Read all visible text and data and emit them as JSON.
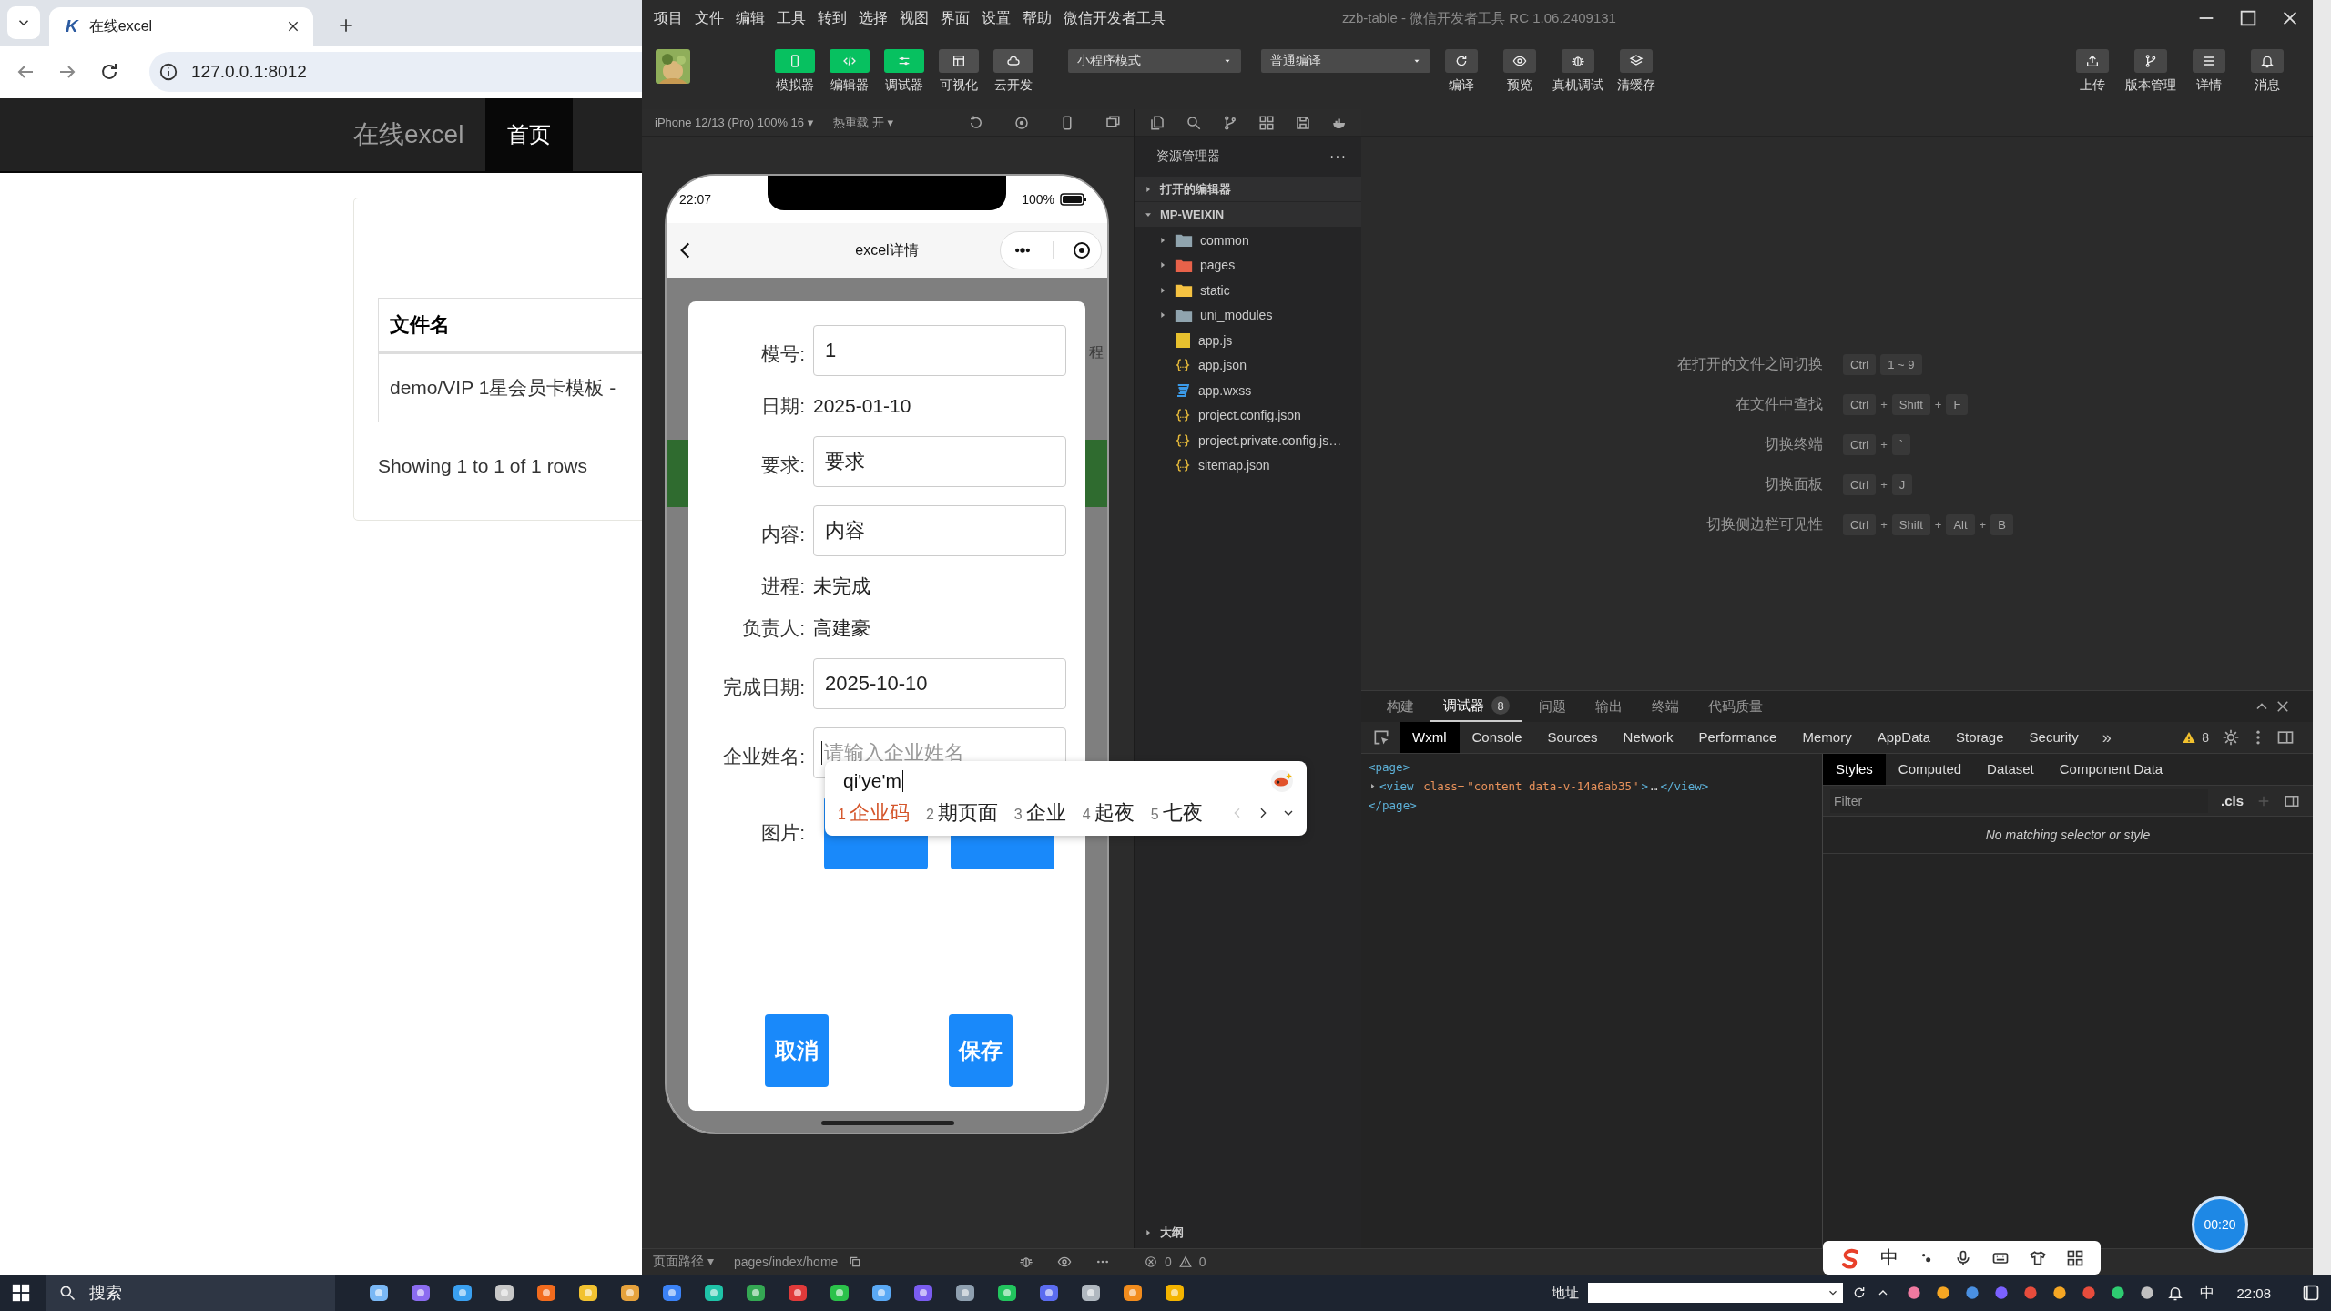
{
  "browser": {
    "tabs": [
      {
        "favicon": "K",
        "title": "在线excel",
        "selected": true
      }
    ],
    "address": "127.0.0.1:8012",
    "site": {
      "brand": "在线excel",
      "nav": [
        {
          "label": "首页",
          "selected": true
        }
      ],
      "table": {
        "columns": [
          "文件名"
        ],
        "rows": [
          [
            "demo/VIP 1星会员卡模板 -"
          ]
        ]
      },
      "pagination": "Showing 1 to 1 of 1 rows"
    }
  },
  "ide": {
    "menu": [
      "项目",
      "文件",
      "编辑",
      "工具",
      "转到",
      "选择",
      "视图",
      "界面",
      "设置",
      "帮助",
      "微信开发者工具"
    ],
    "title": "zzb-table - 微信开发者工具 RC 1.06.2409131",
    "view_buttons": [
      {
        "label": "模拟器",
        "kind": "phone",
        "on": true
      },
      {
        "label": "编辑器",
        "kind": "code",
        "on": true
      },
      {
        "label": "调试器",
        "kind": "sliders",
        "on": true
      },
      {
        "label": "可视化",
        "kind": "layout",
        "on": false
      },
      {
        "label": "云开发",
        "kind": "cloud",
        "on": false
      }
    ],
    "mode_select": "小程序模式",
    "compile_select": "普通编译",
    "actions": [
      {
        "label": "编译",
        "kind": "refresh"
      },
      {
        "label": "预览",
        "kind": "eye"
      },
      {
        "label": "真机调试",
        "kind": "bug"
      },
      {
        "label": "清缓存",
        "kind": "layers"
      }
    ],
    "right_actions": [
      {
        "label": "上传",
        "kind": "upload"
      },
      {
        "label": "版本管理",
        "kind": "branch"
      },
      {
        "label": "详情",
        "kind": "menu"
      },
      {
        "label": "消息",
        "kind": "bell"
      }
    ],
    "simulator": {
      "device": "iPhone 12/13 (Pro) 100% 16 ▾",
      "hot_reload": "热重载 开 ▾",
      "phone": {
        "time": "22:07",
        "battery": "100%",
        "nav_title": "excel详情",
        "behind_text": "程",
        "dialog": {
          "rows": [
            {
              "kind": "input",
              "label": "模号:",
              "value": "1"
            },
            {
              "kind": "text",
              "label": "日期:",
              "value": "2025-01-10"
            },
            {
              "kind": "input",
              "label": "要求:",
              "value": "要求"
            },
            {
              "kind": "input",
              "label": "内容:",
              "value": "内容"
            },
            {
              "kind": "text",
              "label": "进程:",
              "value": "未完成"
            },
            {
              "kind": "text",
              "label": "负责人:",
              "value": "高建豪"
            },
            {
              "kind": "input",
              "label": "完成日期:",
              "value": "2025-10-10"
            },
            {
              "kind": "input",
              "label": "企业姓名:",
              "placeholder": "请输入企业姓名",
              "focused": true
            },
            {
              "kind": "buttons",
              "label": "图片:",
              "buttons": [
                {
                  "kind": "button"
                },
                {
                  "kind": "button"
                }
              ]
            }
          ],
          "actions": [
            "取消",
            "保存"
          ]
        }
      }
    },
    "ime_popup": {
      "composition": "qi'ye'm",
      "candidates": [
        {
          "index": "1",
          "text": "企业码",
          "selected": true
        },
        {
          "index": "2",
          "text": "期页面",
          "selected": false
        },
        {
          "index": "3",
          "text": "企业",
          "selected": false
        },
        {
          "index": "4",
          "text": "起夜",
          "selected": false
        },
        {
          "index": "5",
          "text": "七夜",
          "selected": false
        }
      ]
    },
    "explorer": {
      "title": "资源管理器",
      "more": "···",
      "sections": [
        {
          "label": "打开的编辑器",
          "expanded": false
        },
        {
          "label": "MP-WEIXIN",
          "expanded": true,
          "children": [
            {
              "kind": "folder",
              "name": "common",
              "color": "#90a4ae",
              "expanded": false
            },
            {
              "kind": "folder",
              "name": "pages",
              "color": "#e8624a",
              "expanded": false
            },
            {
              "kind": "folder",
              "name": "static",
              "color": "#f5c242",
              "expanded": false
            },
            {
              "kind": "folder",
              "name": "uni_modules",
              "color": "#90a4ae",
              "expanded": false
            },
            {
              "kind": "js",
              "name": "app.js"
            },
            {
              "kind": "json",
              "name": "app.json"
            },
            {
              "kind": "wxss",
              "name": "app.wxss"
            },
            {
              "kind": "json",
              "name": "project.config.json"
            },
            {
              "kind": "json",
              "name": "project.private.config.js…"
            },
            {
              "kind": "json",
              "name": "sitemap.json"
            }
          ]
        }
      ],
      "outline": {
        "label": "大纲",
        "expanded": false
      }
    },
    "shortcuts": [
      {
        "label": "在打开的文件之间切换",
        "keys": [
          "Ctrl",
          "1 ~ 9"
        ]
      },
      {
        "label": "在文件中查找",
        "keys": [
          "Ctrl",
          "Shift",
          "F"
        ],
        "separator": "+"
      },
      {
        "label": "切换终端",
        "keys": [
          "Ctrl",
          "`"
        ],
        "separator": "+"
      },
      {
        "label": "切换面板",
        "keys": [
          "Ctrl",
          "J"
        ],
        "separator": "+"
      },
      {
        "label": "切换侧边栏可见性",
        "keys": [
          "Ctrl",
          "Shift",
          "Alt",
          "B"
        ],
        "separator": "+"
      }
    ],
    "debugger": {
      "panel_tabs": [
        {
          "label": "构建",
          "selected": false
        },
        {
          "label": "调试器",
          "selected": true,
          "badge": "8"
        },
        {
          "label": "问题",
          "selected": false
        },
        {
          "label": "输出",
          "selected": false
        },
        {
          "label": "终端",
          "selected": false
        },
        {
          "label": "代码质量",
          "selected": false
        }
      ],
      "tools": [
        {
          "label": "Wxml",
          "selected": true
        },
        {
          "label": "Console",
          "selected": false
        },
        {
          "label": "Sources",
          "selected": false
        },
        {
          "label": "Network",
          "selected": false
        },
        {
          "label": "Performance",
          "selected": false
        },
        {
          "label": "Memory",
          "selected": false
        },
        {
          "label": "AppData",
          "selected": false
        },
        {
          "label": "Storage",
          "selected": false
        },
        {
          "label": "Security",
          "selected": false
        }
      ],
      "more": "»",
      "warnings": "8",
      "dom": [
        {
          "expandable": false,
          "parts": [
            {
              "kind": "tag",
              "text": "<page>"
            }
          ]
        },
        {
          "expandable": true,
          "parts": [
            {
              "kind": "tag",
              "text": "<view"
            },
            {
              "kind": "attr",
              "text": " class="
            },
            {
              "kind": "value",
              "text": "\"content data-v-14a6ab35\""
            },
            {
              "kind": "tag",
              "text": ">"
            },
            {
              "kind": "plain",
              "text": "…"
            },
            {
              "kind": "tag",
              "text": "</view>"
            }
          ]
        },
        {
          "expandable": false,
          "parts": [
            {
              "kind": "tag",
              "text": "</page>"
            }
          ]
        }
      ],
      "style_tabs": [
        {
          "label": "Styles",
          "selected": true
        },
        {
          "label": "Computed",
          "selected": false
        },
        {
          "label": "Dataset",
          "selected": false
        },
        {
          "label": "Component Data",
          "selected": false
        }
      ],
      "filter_placeholder": "Filter",
      "cls": ".cls",
      "empty": "No matching selector or style"
    },
    "status_bar": {
      "page_path": "页面路径 ▾",
      "route": "pages/index/home",
      "errors": "0",
      "warnings": "0"
    }
  },
  "ime_toolbar": {
    "mode": "中"
  },
  "timer": "00:20",
  "taskbar": {
    "search": "搜索",
    "address_label": "地址",
    "ime": "中",
    "clock": "22:08"
  }
}
